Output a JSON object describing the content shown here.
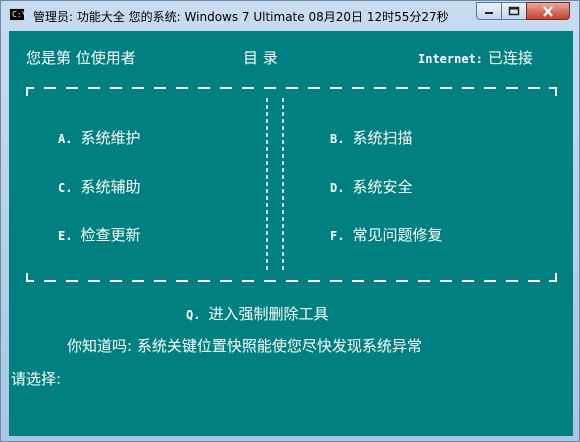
{
  "window": {
    "icon_text": "C:\\",
    "title": "管理员:  功能大全 您的系统: Windows 7 Ultimate   08月20日 12时55分27秒"
  },
  "header": {
    "user_info": "您是第  位使用者",
    "menu_title": "目  录",
    "internet_label": "Internet:",
    "internet_status": "已连接"
  },
  "menu": {
    "items": [
      {
        "key": "A.",
        "label": "系统维护"
      },
      {
        "key": "B.",
        "label": "系统扫描"
      },
      {
        "key": "C.",
        "label": "系统辅助"
      },
      {
        "key": "D.",
        "label": "系统安全"
      },
      {
        "key": "E.",
        "label": "检查更新"
      },
      {
        "key": "F.",
        "label": "常见问题修复"
      }
    ],
    "extra": {
      "key": "Q.",
      "label": "进入强制删除工具"
    }
  },
  "tip": "你知道吗: 系统关键位置快照能使您尽快发现系统异常",
  "prompt": "请选择:",
  "colors": {
    "console_bg": "#008080",
    "console_text": "#ffffff",
    "close_button": "#c4422f"
  },
  "icons": [
    "console-app-icon",
    "minimize-icon",
    "maximize-icon",
    "close-icon"
  ]
}
